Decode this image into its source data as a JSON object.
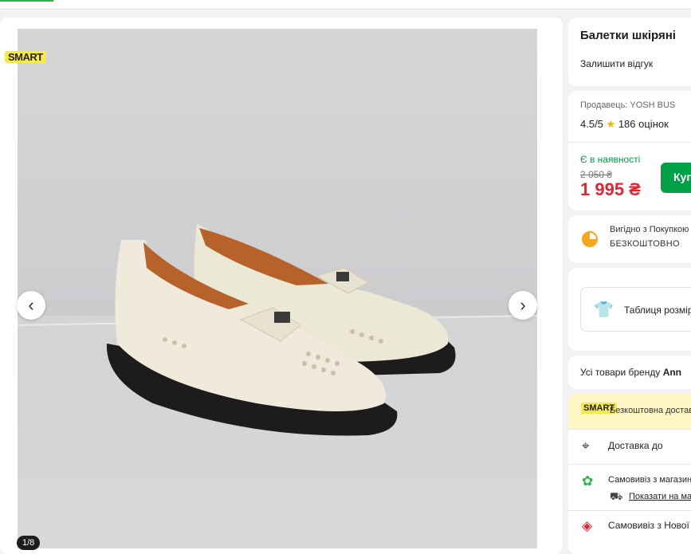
{
  "gallery": {
    "watermark": "SMART",
    "counter": "1/8",
    "prev_label": "‹",
    "next_label": "›"
  },
  "product": {
    "title": "Балетки шкіряні",
    "review_link": "Залишити відгук"
  },
  "seller": {
    "line": "Продавець: YOSH BUS",
    "rating": "4.5/5",
    "reviews_count": "186 оцінок"
  },
  "price": {
    "availability": "Є в наявності",
    "old_price": "2 050 ₴",
    "current_price": "1 995 ₴",
    "buy_label": "Купити"
  },
  "payment": {
    "line1": "Вигідно з Покупкою частинами",
    "line2": "БЕЗКОШТОВНО"
  },
  "size_table": {
    "label": "Таблиця розмірів"
  },
  "brand": {
    "prefix": "Усі товари бренду",
    "name": "Ann"
  },
  "delivery": {
    "promo_logo": "SMART",
    "promo_text": "Безкоштовна доставка",
    "address_label": "Доставка до",
    "pickup_store": "Самовивіз з магазину",
    "show_on_map": "Показати на мапі",
    "pickup_np": "Самовивіз з Нової пошти"
  },
  "colors": {
    "green": "#00a046",
    "price_red": "#e2252f",
    "star": "#f5b301"
  }
}
